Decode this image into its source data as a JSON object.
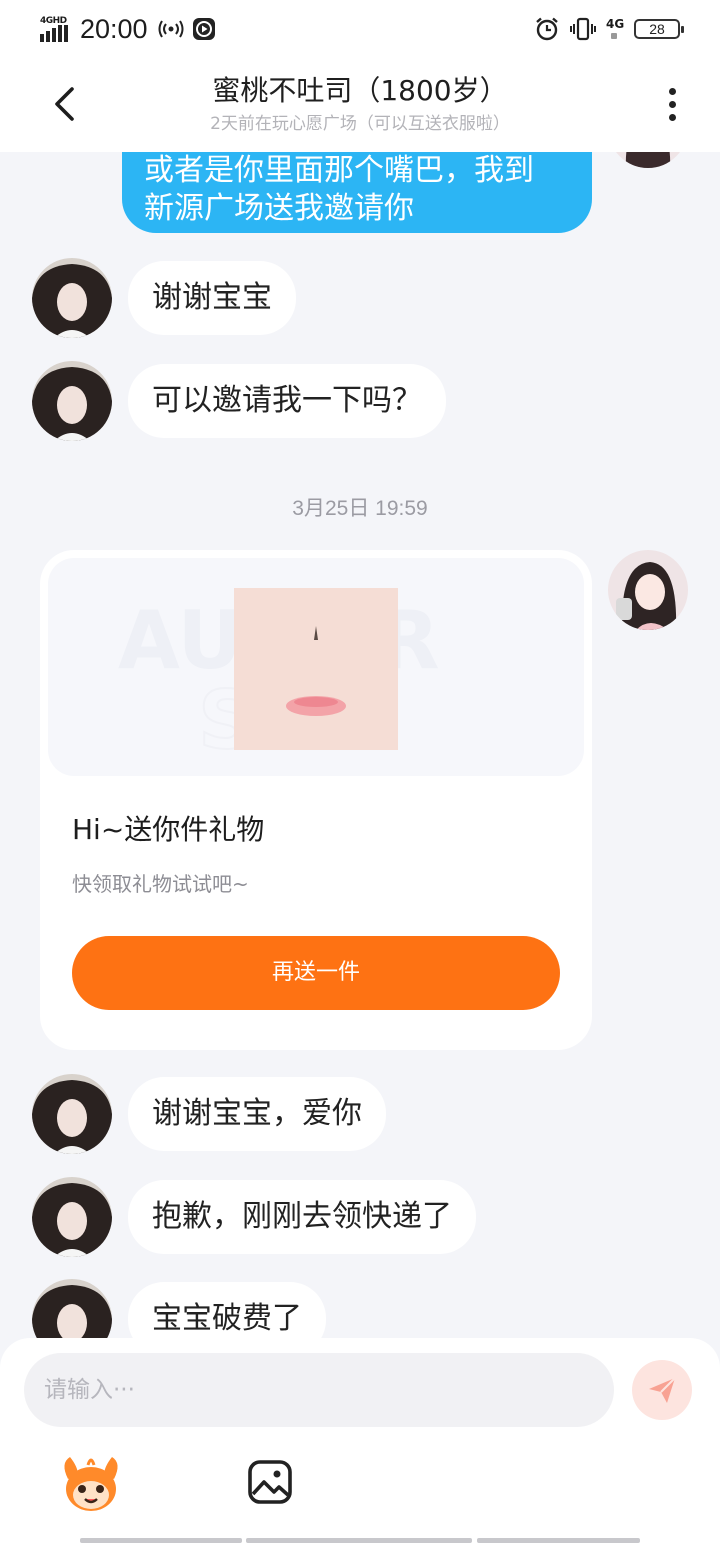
{
  "status_bar": {
    "network_type": "4GHD",
    "time": "20:00",
    "network_right": "4G",
    "battery": "28"
  },
  "header": {
    "title": "蜜桃不吐司（1800岁）",
    "subtitle": "2天前在玩心愿广场（可以互送衣服啦）"
  },
  "messages": {
    "outgoing_partial": [
      "或者是你里面那个嘴巴，我到",
      "新源广场送我邀请你"
    ],
    "incoming": [
      "谢谢宝宝",
      "可以邀请我一下吗？",
      "谢谢宝宝，爱你",
      "抱歉，刚刚去领快递了",
      "宝宝破费了"
    ],
    "timestamp": "3月25日 19:59"
  },
  "gift_card": {
    "title": "Hi~送你件礼物",
    "description": "快领取礼物试试吧~",
    "button_label": "再送一件"
  },
  "input": {
    "placeholder": "请输入···"
  },
  "icons": {
    "back": "chevron-left-icon",
    "more": "more-vertical-icon",
    "send": "paper-plane-icon",
    "mascot": "mascot-emoji-icon",
    "gallery": "image-icon"
  },
  "colors": {
    "outgoing_bubble": "#2cb5f4",
    "gift_button": "#fe7213",
    "send_button_bg": "#fde4df",
    "send_button_icon": "#f8a293"
  }
}
